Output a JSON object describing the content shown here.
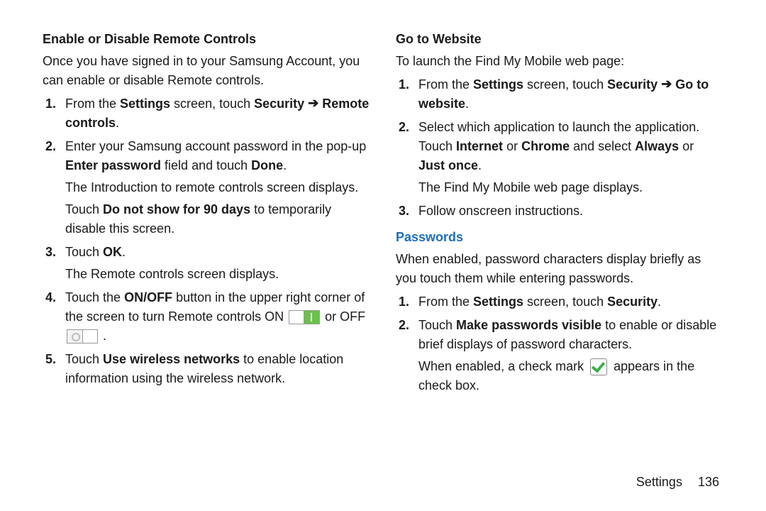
{
  "left": {
    "heading": "Enable or Disable Remote Controls",
    "intro": "Once you have signed in to your Samsung Account, you can enable or disable Remote controls.",
    "steps": {
      "s1_a": "From the ",
      "s1_b": "Settings",
      "s1_c": " screen, touch ",
      "s1_d": "Security",
      "s1_e": "Remote controls",
      "s1_f": ".",
      "s2_a": "Enter your Samsung account password in the pop-up ",
      "s2_b": "Enter password",
      "s2_c": " field and touch ",
      "s2_d": "Done",
      "s2_e": ".",
      "s2_sub1": "The Introduction to remote controls screen displays.",
      "s2_sub2_a": "Touch ",
      "s2_sub2_b": "Do not show for 90 days",
      "s2_sub2_c": " to temporarily disable this screen.",
      "s3_a": "Touch ",
      "s3_b": "OK",
      "s3_c": ".",
      "s3_sub": "The Remote controls screen displays.",
      "s4_a": "Touch the ",
      "s4_b": "ON/OFF",
      "s4_c": " button in the upper right corner of the screen to turn Remote controls ON ",
      "s4_d": " or OFF ",
      "s4_e": " .",
      "s5_a": "Touch ",
      "s5_b": "Use wireless networks",
      "s5_c": " to enable location information using the wireless network."
    }
  },
  "right": {
    "heading": "Go to Website",
    "intro": "To launch the Find My Mobile web page:",
    "steps": {
      "s1_a": "From the ",
      "s1_b": "Settings",
      "s1_c": " screen, touch ",
      "s1_d": "Security",
      "s1_e": "Go to website",
      "s1_f": ".",
      "s2_a": "Select which application to launch the application. Touch ",
      "s2_b": "Internet",
      "s2_c": " or ",
      "s2_d": "Chrome",
      "s2_e": " and select ",
      "s2_f": "Always",
      "s2_g": " or ",
      "s2_h": "Just once",
      "s2_i": ".",
      "s2_sub": "The Find My Mobile web page displays.",
      "s3": "Follow onscreen instructions."
    },
    "section_title": "Passwords",
    "pw_intro": "When enabled, password characters display briefly as you touch them while entering passwords.",
    "pw_steps": {
      "s1_a": "From the ",
      "s1_b": "Settings",
      "s1_c": " screen, touch ",
      "s1_d": "Security",
      "s1_e": ".",
      "s2_a": "Touch ",
      "s2_b": "Make passwords visible",
      "s2_c": " to enable or disable brief displays of password characters.",
      "s2_sub_a": "When enabled, a check mark ",
      "s2_sub_b": " appears in the check box."
    }
  },
  "arrow": "➔",
  "footer": {
    "label": "Settings",
    "page": "136"
  }
}
